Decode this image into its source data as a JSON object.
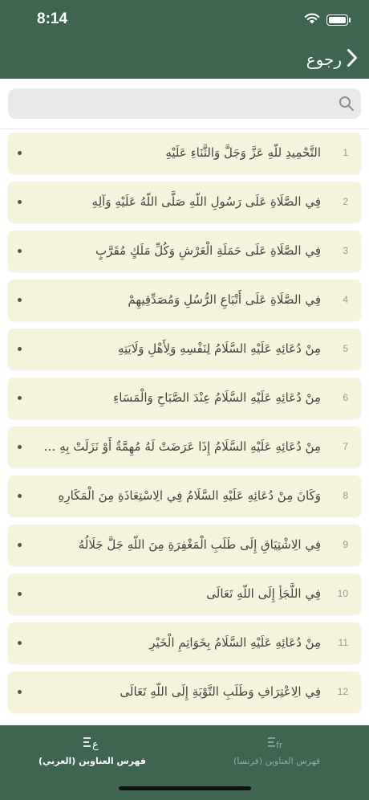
{
  "status_bar": {
    "time": "8:14"
  },
  "header": {
    "back_label": "رجوع"
  },
  "search": {
    "placeholder": ""
  },
  "items": [
    {
      "number": "1",
      "title": "التَّحْمِيدِ للّهِ عَزَّ وَجَلَّ وَالثَّنَاءِ عَلَيْهِ"
    },
    {
      "number": "2",
      "title": "فِي الصَّلَاةِ عَلَى رَسُولِ اللّهِ صَلَّى اللّهُ عَلَيْهِ وَآلِهِ"
    },
    {
      "number": "3",
      "title": "فِي الصَّلَاةِ عَلَى حَمَلَةِ الْعَرْشِ وَكُلِّ مَلَكٍ مُقَرَّبٍ"
    },
    {
      "number": "4",
      "title": "فِي الصَّلَاةِ عَلَى أَتْبَاعِ الرُّسُلِ وَمُصَدِّقِيهِمْ"
    },
    {
      "number": "5",
      "title": "مِنْ دُعَائِهِ عَلَيْهِ السَّلَامُ لِنَفْسِهِ وَلِأَهْلِ وَلَايَتِهِ"
    },
    {
      "number": "6",
      "title": "مِنْ دُعَائِهِ عَلَيْهِ السَّلَامُ عِنْدَ الصَّبَاحِ وَالْمَسَاءِ"
    },
    {
      "number": "7",
      "title": "مِنْ دُعَائِهِ عَلَيْهِ السَّلَامُ إِذَا عَرَضَتْ لَهُ مُهِمَّةٌ أَوْ نَزَلَتْ بِهِ مُلِمَّةٌ"
    },
    {
      "number": "8",
      "title": "وَكَانَ مِنْ دُعَائِهِ عَلَيْهِ السَّلَامُ فِي الِاسْتِعَاذَةِ مِنَ الْمَكَارِهِ"
    },
    {
      "number": "9",
      "title": "فِي الِاشْتِيَاقِ إِلَى طَلَبِ الْمَغْفِرَةِ مِنَ اللّهِ جَلَّ جَلَالُهُ"
    },
    {
      "number": "10",
      "title": "فِي اللَّجَأِ إِلَى اللّهِ تَعَالَى"
    },
    {
      "number": "11",
      "title": "مِنْ دُعَائِهِ عَلَيْهِ السَّلَامُ بِخَوَاتِمِ الْخَيْرِ"
    },
    {
      "number": "12",
      "title": "فِي الِاعْتِرَافِ وَطَلَبِ التَّوْبَةِ إِلَى اللّهِ تَعَالَى"
    }
  ],
  "tabs": [
    {
      "label": "فهرس العناوين (العربي)",
      "icon_text": "ع",
      "active": true
    },
    {
      "label": "فهرس العناوين (فرنسا)",
      "icon_text": "fr",
      "active": false
    }
  ],
  "colors": {
    "primary": "#3f6551",
    "item_background": "#f6f3dc",
    "inactive_tab": "#8fa89a"
  }
}
